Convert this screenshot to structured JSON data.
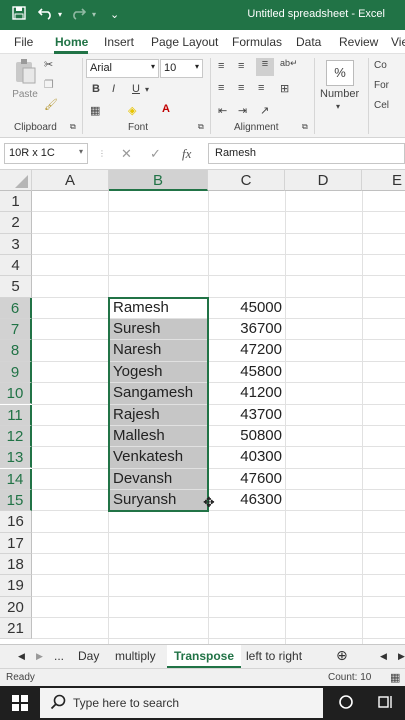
{
  "titlebar": {
    "title": "Untitled spreadsheet  -  Excel",
    "save_icon": "save-icon",
    "undo_icon": "undo-icon",
    "redo_icon": "redo-icon"
  },
  "menu": {
    "items": [
      "File",
      "Home",
      "Insert",
      "Page Layout",
      "Formulas",
      "Data",
      "Review",
      "Vie"
    ]
  },
  "ribbon": {
    "clipboard": {
      "paste_label": "Paste",
      "group_label": "Clipboard"
    },
    "font": {
      "name": "Arial",
      "size": "10",
      "bold": "B",
      "italic": "I",
      "underline": "U",
      "color_letter": "A",
      "group_label": "Font"
    },
    "alignment": {
      "group_label": "Alignment"
    },
    "number": {
      "label": "Number",
      "percent": "%"
    },
    "styles": {
      "items": [
        "Co",
        "For",
        "Cel"
      ]
    }
  },
  "formula_bar": {
    "name_box": "10R x 1C",
    "value": "Ramesh",
    "fx": "fx"
  },
  "sheet": {
    "columns": [
      "A",
      "B",
      "C",
      "D",
      "E"
    ],
    "rows": [
      "1",
      "2",
      "3",
      "4",
      "5",
      "6",
      "7",
      "8",
      "9",
      "10",
      "11",
      "12",
      "13",
      "14",
      "15",
      "16",
      "17",
      "18",
      "19",
      "20",
      "21"
    ],
    "data": [
      {
        "name": "Ramesh",
        "value": "45000"
      },
      {
        "name": "Suresh",
        "value": "36700"
      },
      {
        "name": "Naresh",
        "value": "47200"
      },
      {
        "name": "Yogesh",
        "value": "45800"
      },
      {
        "name": "Sangamesh",
        "value": "41200"
      },
      {
        "name": "Rajesh",
        "value": "43700"
      },
      {
        "name": "Mallesh",
        "value": "50800"
      },
      {
        "name": "Venkatesh",
        "value": "40300"
      },
      {
        "name": "Devansh",
        "value": "47600"
      },
      {
        "name": "Suryansh",
        "value": "46300"
      }
    ]
  },
  "tabs": {
    "ellipsis": "...",
    "items": [
      "Day",
      "multiply",
      "Transpose",
      "left to right"
    ],
    "active": "Transpose"
  },
  "status": {
    "ready": "Ready",
    "count": "Count: 10"
  },
  "taskbar": {
    "search_placeholder": "Type here to search"
  },
  "colors": {
    "accent": "#217346",
    "selection": "#c6c6c6"
  }
}
